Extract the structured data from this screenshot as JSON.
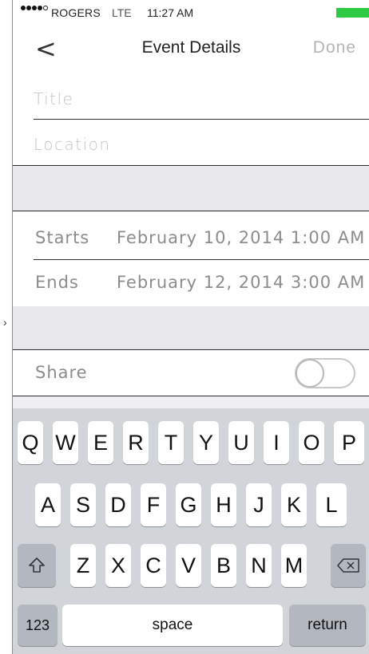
{
  "status_bar": {
    "carrier": "ROGERS",
    "network": "LTE",
    "time": "11:27 AM",
    "battery_color": "#2ecc40"
  },
  "nav": {
    "back_icon": "chevron-left",
    "back_glyph": "<",
    "title": "Event Details",
    "done_label": "Done"
  },
  "fields": {
    "title_placeholder": "Title",
    "location_placeholder": "Location"
  },
  "dates": {
    "starts_label": "Starts",
    "starts_value": "February 10, 2014 1:00 AM",
    "ends_label": "Ends",
    "ends_value": "February 12, 2014 3:00 AM"
  },
  "share": {
    "label": "Share",
    "enabled": false
  },
  "keyboard": {
    "row1": [
      "Q",
      "W",
      "E",
      "R",
      "T",
      "Y",
      "U",
      "I",
      "O",
      "P"
    ],
    "row2": [
      "A",
      "S",
      "D",
      "F",
      "G",
      "H",
      "J",
      "K",
      "L"
    ],
    "row3": [
      "Z",
      "X",
      "C",
      "V",
      "B",
      "N",
      "M"
    ],
    "shift_icon": "shift-arrow",
    "delete_icon": "backspace",
    "numbers_label": "123",
    "space_label": "space",
    "return_label": "return"
  },
  "colors": {
    "section_gray": "#e8e8eb",
    "keyboard_bg": "#d1d4d9",
    "muted_text": "#8c8c8c",
    "placeholder_text": "#c4c4c4"
  }
}
